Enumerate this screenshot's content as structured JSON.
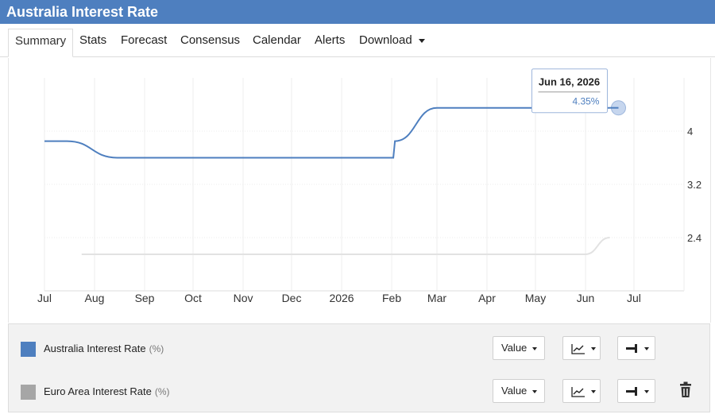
{
  "header": {
    "title": "Australia Interest Rate"
  },
  "tabs": [
    {
      "label": "Summary",
      "active": true
    },
    {
      "label": "Stats"
    },
    {
      "label": "Forecast"
    },
    {
      "label": "Consensus"
    },
    {
      "label": "Calendar"
    },
    {
      "label": "Alerts"
    },
    {
      "label": "Download",
      "dropdown": true
    }
  ],
  "colors": {
    "header": "#4e7fbf",
    "australia": "#4e7fbf",
    "euro_area": "#a6a6a6",
    "euro_line": "#e2e2e2"
  },
  "tooltip": {
    "date": "Jun 16, 2026",
    "value": "4.35%"
  },
  "chart_data": {
    "type": "line",
    "x_tick_labels": [
      "Jul",
      "Aug",
      "Sep",
      "Oct",
      "Nov",
      "Dec",
      "2026",
      "Feb",
      "Mar",
      "Apr",
      "May",
      "Jun",
      "Jul"
    ],
    "y_tick_labels": [
      "4",
      "3.2",
      "2.4"
    ],
    "ylim": [
      1.6,
      4.8
    ],
    "grid": true,
    "legend_position": "bottom",
    "series": [
      {
        "name": "Australia Interest Rate",
        "unit": "(%)",
        "points": [
          [
            "Jul 1",
            3.85
          ],
          [
            "Jul 15",
            3.85
          ],
          [
            "Aug 15",
            3.6
          ],
          [
            "Sep 1",
            3.6
          ],
          [
            "Feb 2",
            3.6
          ],
          [
            "Feb 3",
            3.85
          ],
          [
            "Mar 1",
            4.35
          ],
          [
            "Jun 16",
            4.35
          ]
        ]
      },
      {
        "name": "Euro Area Interest Rate",
        "unit": "(%)",
        "points": [
          [
            "Jul 24",
            2.15
          ],
          [
            "Jun 1",
            2.15
          ],
          [
            "Jun 16",
            2.4
          ]
        ]
      }
    ]
  },
  "legend": {
    "rows": [
      {
        "name": "Australia Interest Rate",
        "unit": "(%)",
        "value_label": "Value",
        "deletable": false
      },
      {
        "name": "Euro Area Interest Rate",
        "unit": "(%)",
        "value_label": "Value",
        "deletable": true
      }
    ]
  },
  "icons": {
    "chart_type": "line-chart-icon",
    "axis": "axis-icon",
    "delete": "trash-icon"
  }
}
